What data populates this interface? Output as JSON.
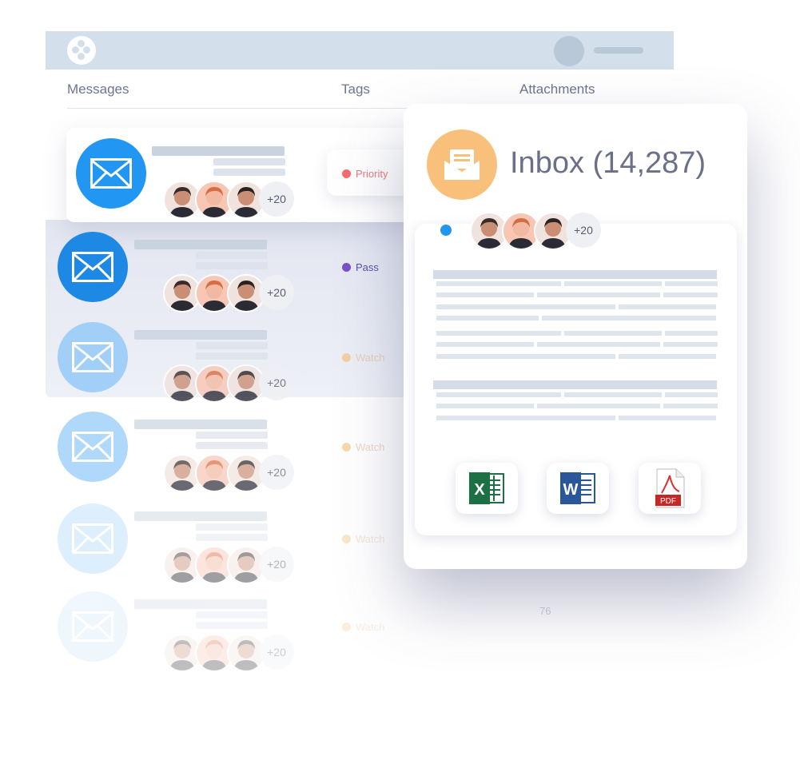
{
  "header": {
    "columns": [
      "Messages",
      "Tags",
      "Attachments"
    ]
  },
  "rows": [
    {
      "tag": "Priority",
      "tag_color": "#f76b6b",
      "text_color": "#f07a7a",
      "avatars_extra": "+20",
      "envelope_color": "#2196f3",
      "opacity": 1
    },
    {
      "tag": "Pass",
      "tag_color": "#7b4fc9",
      "text_color": "#5b4fb0",
      "avatars_extra": "+20",
      "envelope_color": "#1e88e5",
      "opacity": 1
    },
    {
      "tag": "Watch",
      "tag_color": "#f5c98e",
      "text_color": "#e8c7a8",
      "avatars_extra": "+20",
      "envelope_color": "#90c8f8",
      "opacity": 0.8
    },
    {
      "tag": "Watch",
      "tag_color": "#f5c98e",
      "text_color": "#e8c7a8",
      "avatars_extra": "+20",
      "envelope_color": "#90c8f8",
      "opacity": 0.7
    },
    {
      "tag": "Watch",
      "tag_color": "#f5c98e",
      "text_color": "#e8c7a8",
      "avatars_extra": "+20",
      "envelope_color": "#b5dbfa",
      "opacity": 0.45
    },
    {
      "tag": "Watch",
      "tag_color": "#f5c98e",
      "text_color": "#e8c7a8",
      "avatars_extra": "+20",
      "envelope_color": "#cde6fb",
      "opacity": 0.3
    }
  ],
  "faded_attachment_count": "76",
  "inbox": {
    "title": "Inbox",
    "count": "(14,287)",
    "avatars_extra": "+20",
    "unread_dot_color": "#2196f3",
    "icon_color": "#f8c07a"
  },
  "attachments": [
    {
      "type": "excel",
      "label": "X"
    },
    {
      "type": "word",
      "label": "W"
    },
    {
      "type": "pdf",
      "label": "PDF"
    }
  ]
}
